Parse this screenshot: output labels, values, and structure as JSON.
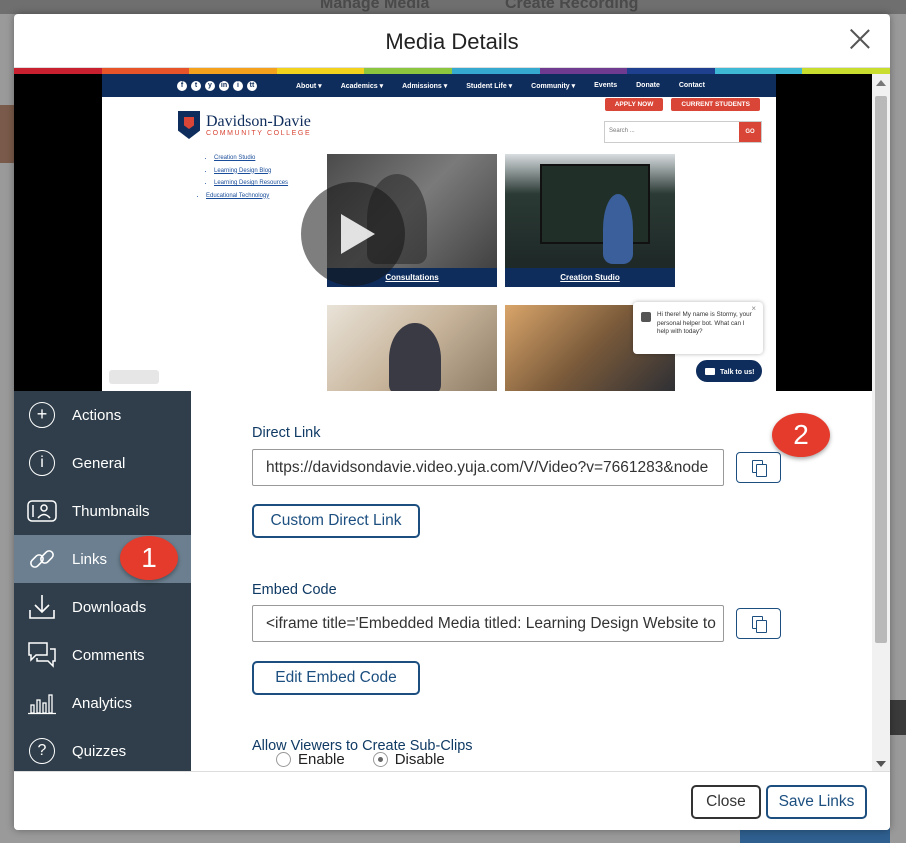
{
  "background": {
    "manage_media": "Manage Media",
    "create_recording": "Create Recording"
  },
  "modal": {
    "title": "Media Details"
  },
  "rainbow_colors": [
    "#c8202f",
    "#e8542a",
    "#f4a21e",
    "#f3d21d",
    "#8cc63f",
    "#36a9d0",
    "#6e3b90",
    "#1f3f8f",
    "#3fb8d6",
    "#c9dd2f"
  ],
  "website": {
    "social": [
      "f",
      "t",
      "y",
      "in",
      "i",
      "tt"
    ],
    "menu": [
      "About ▾",
      "Academics ▾",
      "Admissions ▾",
      "Student Life ▾",
      "Community ▾",
      "Events",
      "Donate",
      "Contact"
    ],
    "apply": "APPLY NOW",
    "current_students": "CURRENT STUDENTS",
    "logo_name": "Davidson-Davie",
    "logo_sub": "COMMUNITY COLLEGE",
    "search_placeholder": "Search ...",
    "search_go": "GO",
    "links": [
      "Creation Studio",
      "Learning Design Blog",
      "Learning Design Resources",
      "Educational Technology"
    ],
    "tile1": "Consultations",
    "tile2": "Creation Studio",
    "chat_text": "Hi there! My name is Stormy, your personal helper bot. What can I help with today?",
    "chat_close": "×",
    "talk": "Talk to us!"
  },
  "sidebar": {
    "items": [
      {
        "label": "Actions",
        "icon": "plus-circle-icon"
      },
      {
        "label": "General",
        "icon": "info-circle-icon"
      },
      {
        "label": "Thumbnails",
        "icon": "thumbnails-icon"
      },
      {
        "label": "Links",
        "icon": "link-icon"
      },
      {
        "label": "Downloads",
        "icon": "download-icon"
      },
      {
        "label": "Comments",
        "icon": "comments-icon"
      },
      {
        "label": "Analytics",
        "icon": "analytics-icon"
      },
      {
        "label": "Quizzes",
        "icon": "question-circle-icon"
      }
    ],
    "active": "Links"
  },
  "annotations": {
    "badge1": "1",
    "badge2": "2",
    "color": "#e53b2c"
  },
  "content": {
    "direct_link_label": "Direct Link",
    "direct_link_value": "https://davidsondavie.video.yuja.com/V/Video?v=7661283&node",
    "custom_direct_link": "Custom Direct Link",
    "embed_code_label": "Embed Code",
    "embed_code_value": "<iframe title='Embedded Media titled: Learning Design Website to",
    "edit_embed_code": "Edit Embed Code",
    "sub_clips_label": "Allow Viewers to Create Sub-Clips",
    "enable": "Enable",
    "disable": "Disable",
    "selected": "Disable"
  },
  "footer": {
    "close": "Close",
    "save_links": "Save Links"
  },
  "accent_color": "#1c4f80",
  "sidebar_color": "#2f3e4a"
}
